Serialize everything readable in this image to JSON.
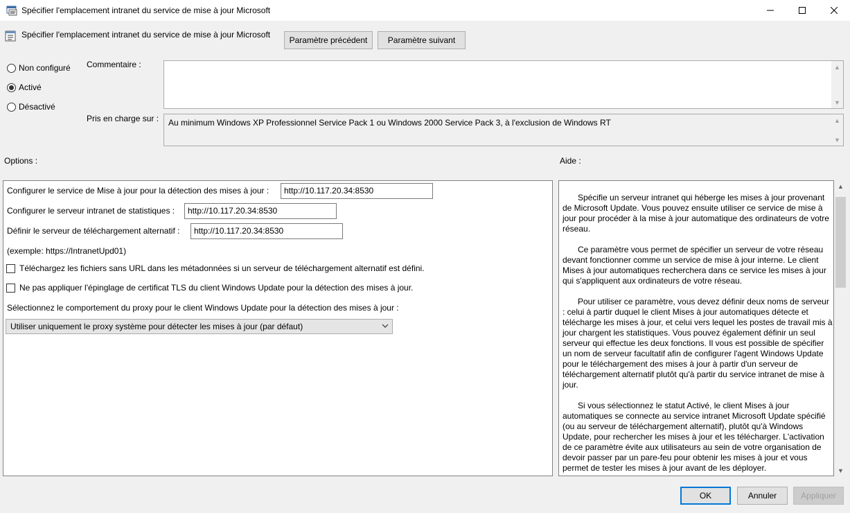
{
  "window": {
    "title": "Spécifier l'emplacement intranet du service de mise à jour Microsoft",
    "controls": {
      "minimize": "—",
      "maximize": "☐",
      "close": "✕"
    }
  },
  "header": {
    "title": "Spécifier l'emplacement intranet du service de mise à jour Microsoft",
    "prev_label": "Paramètre précédent",
    "next_label": "Paramètre suivant"
  },
  "state": {
    "options": [
      {
        "label": "Non configuré",
        "checked": false
      },
      {
        "label": "Activé",
        "checked": true
      },
      {
        "label": "Désactivé",
        "checked": false
      }
    ]
  },
  "comment": {
    "label": "Commentaire :",
    "value": ""
  },
  "supported": {
    "label": "Pris en charge sur :",
    "value": "Au minimum Windows XP Professionnel Service Pack 1 ou Windows 2000 Service Pack 3, à l'exclusion de Windows RT"
  },
  "options_label": "Options :",
  "help_label": "Aide :",
  "options": {
    "detection_label": "Configurer le service de Mise à jour pour la détection des mises à jour :",
    "detection_value": "http://10.117.20.34:8530",
    "stats_label": "Configurer le serveur intranet de statistiques :",
    "stats_value": "http://10.117.20.34:8530",
    "altdl_label": "Définir le serveur de téléchargement alternatif :",
    "altdl_value": "http://10.117.20.34:8530",
    "example": "(exemple: https://IntranetUpd01)",
    "chk1_label": "Téléchargez les fichiers sans URL dans les métadonnées si un serveur de téléchargement alternatif est défini.",
    "chk1_checked": false,
    "chk2_label": "Ne pas appliquer l'épinglage de certificat TLS du client Windows Update pour la détection des mises à jour.",
    "chk2_checked": false,
    "proxy_label": "Sélectionnez le comportement du proxy pour le client Windows Update pour la détection des mises à jour :",
    "proxy_value": "Utiliser uniquement le proxy système pour détecter les mises à jour (par défaut)"
  },
  "help": {
    "p1": "Spécifie un serveur intranet qui héberge les mises à jour provenant de Microsoft Update. Vous pouvez ensuite utiliser ce service de mise à jour pour procéder à la mise à jour automatique des ordinateurs de votre réseau.",
    "p2": "Ce paramètre vous permet de spécifier un serveur de votre réseau devant fonctionner comme un service de mise à jour interne. Le client Mises à jour automatiques recherchera dans ce service les mises à jour qui s'appliquent aux ordinateurs de votre réseau.",
    "p3": "Pour utiliser ce paramètre, vous devez définir deux noms de serveur : celui à partir duquel le client Mises à jour automatiques détecte et télécharge les mises à jour, et celui vers lequel les postes de travail mis à jour chargent les statistiques. Vous pouvez également définir un seul serveur qui effectue les deux fonctions. Il vous est possible de spécifier un nom de serveur facultatif afin de configurer l'agent Windows Update pour le téléchargement des mises à jour à partir d'un serveur de téléchargement alternatif plutôt qu'à partir du service intranet de mise à jour.",
    "p4": "Si vous sélectionnez le statut Activé, le client Mises à jour automatiques se connecte au service intranet Microsoft Update spécifié (ou au serveur de téléchargement alternatif), plutôt qu'à Windows Update, pour rechercher les mises à jour et les télécharger. L'activation de ce paramètre évite aux utilisateurs au sein de votre organisation de devoir passer par un pare-feu pour obtenir les mises à jour et vous permet de tester les mises à jour avant de les déployer."
  },
  "footer": {
    "ok": "OK",
    "cancel": "Annuler",
    "apply": "Appliquer"
  },
  "icons": [
    "policy-app-icon",
    "policy-header-icon",
    "minimize-icon",
    "maximize-icon",
    "close-icon",
    "chevron-down-icon",
    "scroll-up-icon",
    "scroll-down-icon"
  ]
}
